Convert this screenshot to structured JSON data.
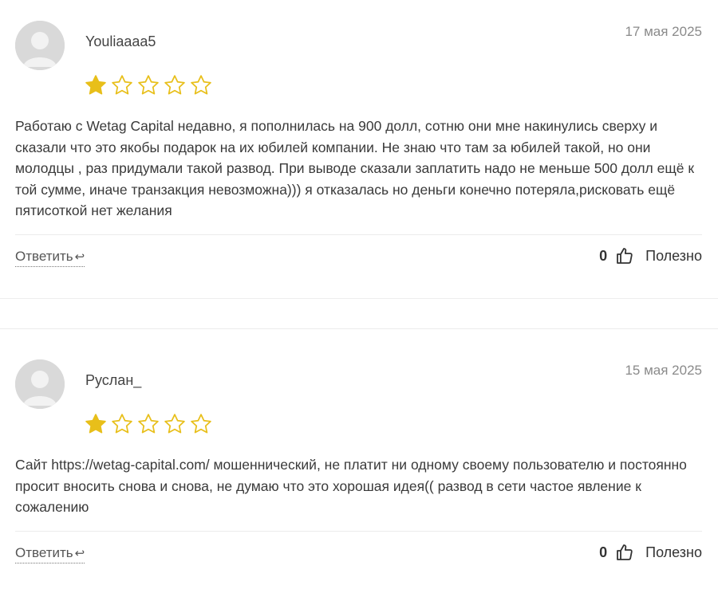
{
  "reviews": [
    {
      "author": "Youliaaaa5",
      "date": "17 мая 2025",
      "rating": 1,
      "max_rating": 5,
      "text": "Работаю с Wetag Capital недавно, я пополнилась на 900 долл, сотню они мне накинулись сверху и сказали что это якобы подарок на их юбилей компании. Не знаю что там за юбилей такой, но они молодцы , раз придумали такой развод. При выводе сказали заплатить надо не меньше 500 долл ещё к той сумме, иначе транзакция невозможна))) я отказалась но деньги конечно потеряла,рисковать ещё пятисоткой нет желания",
      "reply_label": "Ответить",
      "useful_count": "0",
      "useful_label": "Полезно"
    },
    {
      "author": "Руслан_",
      "date": "15 мая 2025",
      "rating": 1,
      "max_rating": 5,
      "text": "Сайт https://wetag-capital.com/ мошеннический, не платит ни одному своему пользователю и постоянно просит вносить снова и снова, не думаю что это хорошая идея(( развод в сети частое явление к сожалению",
      "reply_label": "Ответить",
      "useful_count": "0",
      "useful_label": "Полезно"
    }
  ],
  "icons": {
    "reply": "reply-arrow-icon",
    "useful": "thumbs-up-icon",
    "star": "star-icon",
    "avatar": "user-avatar-icon"
  },
  "colors": {
    "star_filled": "#e8bf1a",
    "star_outline": "#e8bf1a",
    "avatar_bg": "#d9d9d9"
  }
}
